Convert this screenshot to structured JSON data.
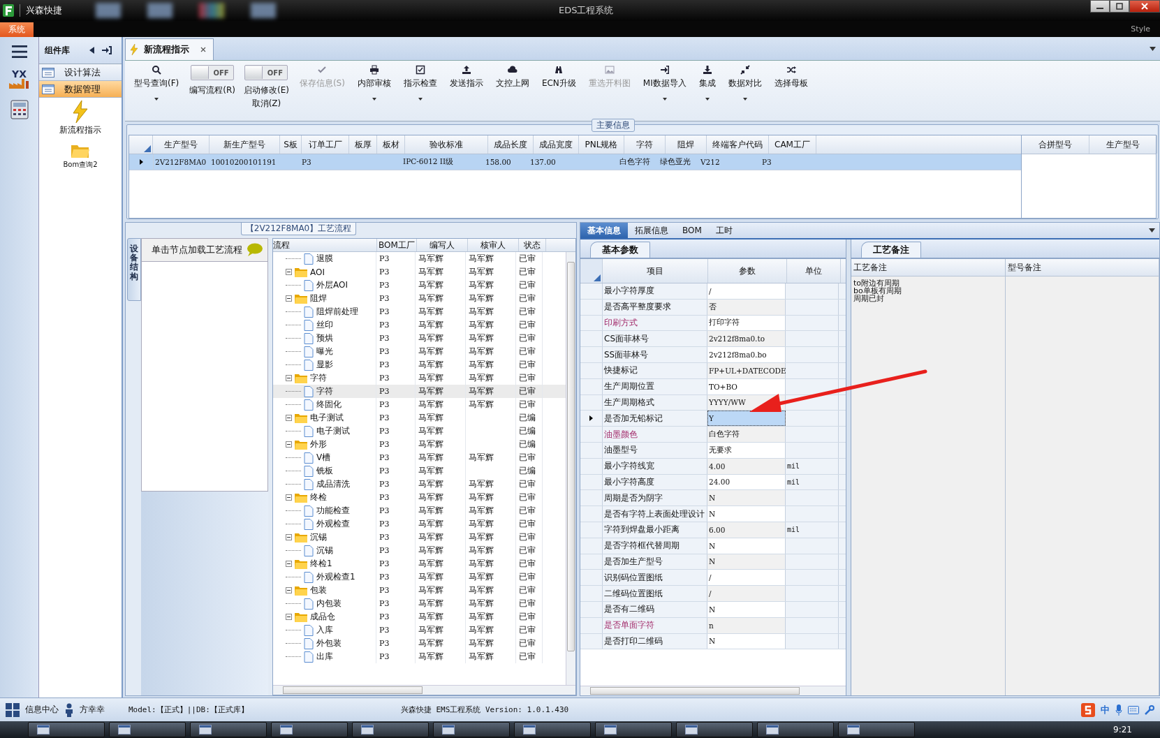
{
  "window": {
    "app_name": "兴森快捷",
    "title": "EDS工程系统",
    "style_label": "Style"
  },
  "menu": [
    {
      "label": "系统",
      "selected": true
    }
  ],
  "component_library": {
    "title": "组件库",
    "items": [
      {
        "label": "设计算法",
        "selected": false
      },
      {
        "label": "数据管理",
        "selected": true
      }
    ],
    "tools": [
      {
        "label": "新流程指示",
        "kind": "lightning"
      },
      {
        "label": "Bom查询2",
        "kind": "folder"
      }
    ]
  },
  "logo_text": "YX",
  "document_tab": {
    "label": "新流程指示",
    "selected": true
  },
  "toolbar": [
    {
      "kind": "button",
      "label": "型号查询(F)",
      "dropdown": true,
      "disabled": false
    },
    {
      "kind": "toggle",
      "switch_text": "OFF",
      "on": false,
      "label": "编写流程(R)"
    },
    {
      "kind": "toggle",
      "switch_text": "OFF",
      "on": false,
      "label": "启动修改(E)",
      "second_label": "取消(Z)"
    },
    {
      "kind": "button",
      "label": "保存信息(S)",
      "dropdown": false,
      "disabled": true
    },
    {
      "kind": "button",
      "label": "内部审核",
      "dropdown": true,
      "disabled": false
    },
    {
      "kind": "button",
      "label": "指示检查",
      "dropdown": true,
      "disabled": false
    },
    {
      "kind": "button",
      "label": "发送指示",
      "dropdown": false,
      "disabled": false
    },
    {
      "kind": "button",
      "label": "文控上网",
      "dropdown": false,
      "disabled": false
    },
    {
      "kind": "button",
      "label": "ECN升级",
      "dropdown": false,
      "disabled": false
    },
    {
      "kind": "button",
      "label": "重选开料图",
      "dropdown": false,
      "disabled": true
    },
    {
      "kind": "button",
      "label": "MI数据导入",
      "dropdown": true,
      "disabled": false
    },
    {
      "kind": "button",
      "label": "集成",
      "dropdown": true,
      "disabled": false
    },
    {
      "kind": "button",
      "label": "数据对比",
      "dropdown": true,
      "disabled": false
    },
    {
      "kind": "button",
      "label": "选择母板",
      "dropdown": false,
      "disabled": false
    }
  ],
  "main_info": {
    "title": "主要信息",
    "columns": [
      "生产型号",
      "新生产型号",
      "S板",
      "订单工厂",
      "板厚",
      "板材",
      "验收标准",
      "成品长度",
      "成品宽度",
      "PNL规格",
      "字符",
      "阻焊",
      "终端客户代码",
      "CAM工厂"
    ],
    "rows": [
      {
        "selected": true,
        "cells": [
          "2V212F8MA0",
          "10010200101191",
          null,
          "P3",
          null,
          null,
          "IPC-6012 II级",
          "158.00",
          "137.00",
          null,
          "白色字符",
          "绿色亚光",
          "V212",
          "P3"
        ]
      }
    ],
    "side_columns": [
      "合拼型号",
      "生产型号"
    ]
  },
  "flow": {
    "title": "【2V212F8MA0】工艺流程",
    "side_tab": "设备结构",
    "hint": "单击节点加载工艺流程",
    "columns": [
      "流程",
      "BOM工厂",
      "编写人",
      "核审人",
      "状态"
    ],
    "rows": [
      {
        "label": "退膜",
        "kind": "doc",
        "factory": "P3",
        "author": "马军辉",
        "reviewer": "马军辉",
        "status": "已审",
        "selected": false
      },
      {
        "label": "AOI",
        "kind": "folder",
        "expanded": true,
        "factory": "P3",
        "author": "马军辉",
        "reviewer": "马军辉",
        "status": "已审",
        "selected": false,
        "children": [
          {
            "label": "外层AOI",
            "kind": "doc",
            "factory": "P3",
            "author": "马军辉",
            "reviewer": "马军辉",
            "status": "已审",
            "selected": false
          }
        ]
      },
      {
        "label": "阻焊",
        "kind": "folder",
        "expanded": true,
        "factory": "P3",
        "author": "马军辉",
        "reviewer": "马军辉",
        "status": "已审",
        "selected": false,
        "children": [
          {
            "label": "阻焊前处理",
            "kind": "doc",
            "factory": "P3",
            "author": "马军辉",
            "reviewer": "马军辉",
            "status": "已审",
            "selected": false
          },
          {
            "label": "丝印",
            "kind": "doc",
            "factory": "P3",
            "author": "马军辉",
            "reviewer": "马军辉",
            "status": "已审",
            "selected": false
          },
          {
            "label": "预烘",
            "kind": "doc",
            "factory": "P3",
            "author": "马军辉",
            "reviewer": "马军辉",
            "status": "已审",
            "selected": false
          },
          {
            "label": "曝光",
            "kind": "doc",
            "factory": "P3",
            "author": "马军辉",
            "reviewer": "马军辉",
            "status": "已审",
            "selected": false
          },
          {
            "label": "显影",
            "kind": "doc",
            "factory": "P3",
            "author": "马军辉",
            "reviewer": "马军辉",
            "status": "已审",
            "selected": false
          }
        ]
      },
      {
        "label": "字符",
        "kind": "folder",
        "expanded": true,
        "factory": "P3",
        "author": "马军辉",
        "reviewer": "马军辉",
        "status": "已审",
        "selected": false,
        "children": [
          {
            "label": "字符",
            "kind": "doc",
            "factory": "P3",
            "author": "马军辉",
            "reviewer": "马军辉",
            "status": "已审",
            "selected": true
          },
          {
            "label": "终固化",
            "kind": "doc",
            "factory": "P3",
            "author": "马军辉",
            "reviewer": "马军辉",
            "status": "已审",
            "selected": false
          }
        ]
      },
      {
        "label": "电子测试",
        "kind": "folder",
        "expanded": true,
        "factory": "P3",
        "author": "马军辉",
        "status": "已编",
        "selected": false,
        "children": [
          {
            "label": "电子测试",
            "kind": "doc",
            "factory": "P3",
            "author": "马军辉",
            "status": "已编",
            "selected": false
          }
        ]
      },
      {
        "label": "外形",
        "kind": "folder",
        "expanded": true,
        "factory": "P3",
        "author": "马军辉",
        "status": "已编",
        "selected": false,
        "children": [
          {
            "label": "V槽",
            "kind": "doc",
            "factory": "P3",
            "author": "马军辉",
            "reviewer": "马军辉",
            "status": "已审",
            "selected": false
          },
          {
            "label": "铣板",
            "kind": "doc",
            "factory": "P3",
            "author": "马军辉",
            "status": "已编",
            "selected": false
          },
          {
            "label": "成品清洗",
            "kind": "doc",
            "factory": "P3",
            "author": "马军辉",
            "reviewer": "马军辉",
            "status": "已审",
            "selected": false
          }
        ]
      },
      {
        "label": "终检",
        "kind": "folder",
        "expanded": true,
        "factory": "P3",
        "author": "马军辉",
        "reviewer": "马军辉",
        "status": "已审",
        "selected": false,
        "children": [
          {
            "label": "功能检查",
            "kind": "doc",
            "factory": "P3",
            "author": "马军辉",
            "reviewer": "马军辉",
            "status": "已审",
            "selected": false
          },
          {
            "label": "外观检查",
            "kind": "doc",
            "factory": "P3",
            "author": "马军辉",
            "reviewer": "马军辉",
            "status": "已审",
            "selected": false
          }
        ]
      },
      {
        "label": "沉锡",
        "kind": "folder",
        "expanded": true,
        "factory": "P3",
        "author": "马军辉",
        "reviewer": "马军辉",
        "status": "已审",
        "selected": false,
        "children": [
          {
            "label": "沉锡",
            "kind": "doc",
            "factory": "P3",
            "author": "马军辉",
            "reviewer": "马军辉",
            "status": "已审",
            "selected": false
          }
        ]
      },
      {
        "label": "终检1",
        "kind": "folder",
        "expanded": true,
        "factory": "P3",
        "author": "马军辉",
        "reviewer": "马军辉",
        "status": "已审",
        "selected": false,
        "children": [
          {
            "label": "外观检查1",
            "kind": "doc",
            "factory": "P3",
            "author": "马军辉",
            "reviewer": "马军辉",
            "status": "已审",
            "selected": false
          }
        ]
      },
      {
        "label": "包装",
        "kind": "folder",
        "expanded": true,
        "factory": "P3",
        "author": "马军辉",
        "reviewer": "马军辉",
        "status": "已审",
        "selected": false,
        "children": [
          {
            "label": "内包装",
            "kind": "doc",
            "factory": "P3",
            "author": "马军辉",
            "reviewer": "马军辉",
            "status": "已审",
            "selected": false
          }
        ]
      },
      {
        "label": "成品仓",
        "kind": "folder",
        "expanded": true,
        "factory": "P3",
        "author": "马军辉",
        "reviewer": "马军辉",
        "status": "已审",
        "selected": false,
        "children": [
          {
            "label": "入库",
            "kind": "doc",
            "factory": "P3",
            "author": "马军辉",
            "reviewer": "马军辉",
            "status": "已审",
            "selected": false
          },
          {
            "label": "外包装",
            "kind": "doc",
            "factory": "P3",
            "author": "马军辉",
            "reviewer": "马军辉",
            "status": "已审",
            "selected": false
          },
          {
            "label": "出库",
            "kind": "doc",
            "factory": "P3",
            "author": "马军辉",
            "reviewer": "马军辉",
            "status": "已审",
            "selected": false
          }
        ]
      }
    ]
  },
  "detail_tabs": [
    {
      "label": "基本信息",
      "selected": true
    },
    {
      "label": "拓展信息",
      "selected": false
    },
    {
      "label": "BOM",
      "selected": false
    },
    {
      "label": "工时",
      "selected": false
    }
  ],
  "params": {
    "title": "基本参数",
    "columns": [
      "项目",
      "参数",
      "单位"
    ],
    "rows": [
      {
        "item": "最小字符厚度",
        "value": "/",
        "highlighted": false,
        "current": false
      },
      {
        "item": "是否高平整度要求",
        "value": "否",
        "highlighted": false,
        "current": false
      },
      {
        "item": "印刷方式",
        "value": "打印字符",
        "highlighted": true,
        "current": false
      },
      {
        "item": "CS面菲林号",
        "value": "2v212f8ma0.to",
        "highlighted": false,
        "current": false
      },
      {
        "item": "SS面菲林号",
        "value": "2v212f8ma0.bo",
        "highlighted": false,
        "current": false
      },
      {
        "item": "快捷标记",
        "value": "FP+UL+DATECODE",
        "highlighted": false,
        "current": false
      },
      {
        "item": "生产周期位置",
        "value": "TO+BO",
        "highlighted": false,
        "current": false
      },
      {
        "item": "生产周期格式",
        "value": "YYYY/WW",
        "highlighted": false,
        "current": false
      },
      {
        "item": "是否加无铅标记",
        "value": "Y",
        "highlighted": false,
        "current": true
      },
      {
        "item": "油墨颜色",
        "value": "白色字符",
        "highlighted": true,
        "current": false
      },
      {
        "item": "油墨型号",
        "value": "无要求",
        "highlighted": false,
        "current": false
      },
      {
        "item": "最小字符线宽",
        "value": "4.00",
        "unit": "mil",
        "highlighted": false,
        "current": false
      },
      {
        "item": "最小字符高度",
        "value": "24.00",
        "unit": "mil",
        "highlighted": false,
        "current": false
      },
      {
        "item": "周期是否为阴字",
        "value": "N",
        "highlighted": false,
        "current": false
      },
      {
        "item": "是否有字符上表面处理设计",
        "value": "N",
        "highlighted": false,
        "current": false
      },
      {
        "item": "字符到焊盘最小距离",
        "value": "6.00",
        "unit": "mil",
        "highlighted": false,
        "current": false
      },
      {
        "item": "是否字符框代替周期",
        "value": "N",
        "highlighted": false,
        "current": false
      },
      {
        "item": "是否加生产型号",
        "value": "N",
        "highlighted": false,
        "current": false
      },
      {
        "item": "识别码位置图纸",
        "value": "/",
        "highlighted": false,
        "current": false
      },
      {
        "item": "二维码位置图纸",
        "value": "/",
        "highlighted": false,
        "current": false
      },
      {
        "item": "是否有二维码",
        "value": "N",
        "highlighted": false,
        "current": false
      },
      {
        "item": "是否单面字符",
        "value": "n",
        "highlighted": true,
        "current": false
      },
      {
        "item": "是否打印二维码",
        "value": "N",
        "highlighted": false,
        "current": false
      }
    ]
  },
  "notes": {
    "title": "工艺备注",
    "columns": [
      "工艺备注",
      "型号备注"
    ],
    "process_note": [
      "to附边有周期",
      "bo单板有周期",
      "周期已封"
    ]
  },
  "status_bar": {
    "info_center": "信息中心",
    "user": "方幸幸",
    "env": "Model:【正式】||DB:【正式库】",
    "version": "兴森快捷 EMS工程系统 Version: 1.0.1.430",
    "ime": "中"
  },
  "taskbar": {
    "clock": "9:21"
  }
}
